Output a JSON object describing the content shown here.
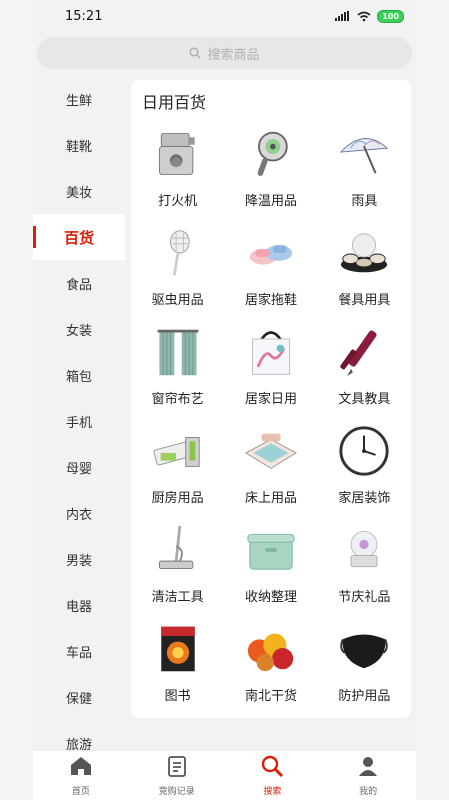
{
  "status": {
    "time": "15:21",
    "battery": "100"
  },
  "search": {
    "placeholder": "搜索商品"
  },
  "sidebar": {
    "items": [
      {
        "label": "生鲜"
      },
      {
        "label": "鞋靴"
      },
      {
        "label": "美妆"
      },
      {
        "label": "百货"
      },
      {
        "label": "食品"
      },
      {
        "label": "女装"
      },
      {
        "label": "箱包"
      },
      {
        "label": "手机"
      },
      {
        "label": "母婴"
      },
      {
        "label": "内衣"
      },
      {
        "label": "男装"
      },
      {
        "label": "电器"
      },
      {
        "label": "车品"
      },
      {
        "label": "保健"
      },
      {
        "label": "旅游"
      }
    ],
    "active_index": 3
  },
  "panel": {
    "title": "日用百货",
    "items": [
      {
        "label": "打火机",
        "icon": "lighter-icon"
      },
      {
        "label": "降温用品",
        "icon": "fan-icon"
      },
      {
        "label": "雨具",
        "icon": "umbrella-icon"
      },
      {
        "label": "驱虫用品",
        "icon": "bug-swatter-icon"
      },
      {
        "label": "居家拖鞋",
        "icon": "slippers-icon"
      },
      {
        "label": "餐具用具",
        "icon": "tableware-icon"
      },
      {
        "label": "窗帘布艺",
        "icon": "curtain-icon"
      },
      {
        "label": "居家日用",
        "icon": "shopping-bag-icon"
      },
      {
        "label": "文具教具",
        "icon": "pen-icon"
      },
      {
        "label": "厨房用品",
        "icon": "slicer-icon"
      },
      {
        "label": "床上用品",
        "icon": "bedding-icon"
      },
      {
        "label": "家居装饰",
        "icon": "wall-clock-icon"
      },
      {
        "label": "清洁工具",
        "icon": "mop-icon"
      },
      {
        "label": "收纳整理",
        "icon": "storage-box-icon"
      },
      {
        "label": "节庆礼品",
        "icon": "music-box-icon"
      },
      {
        "label": "图书",
        "icon": "book-icon"
      },
      {
        "label": "南北干货",
        "icon": "dried-fruit-icon"
      },
      {
        "label": "防护用品",
        "icon": "face-mask-icon"
      }
    ]
  },
  "tabbar": {
    "items": [
      {
        "label": "首页",
        "icon": "home-icon"
      },
      {
        "label": "竞购记录",
        "icon": "record-icon"
      },
      {
        "label": "搜索",
        "icon": "search-icon"
      },
      {
        "label": "我的",
        "icon": "user-icon"
      }
    ],
    "active_index": 2
  },
  "colors": {
    "accent": "#d81e06"
  }
}
